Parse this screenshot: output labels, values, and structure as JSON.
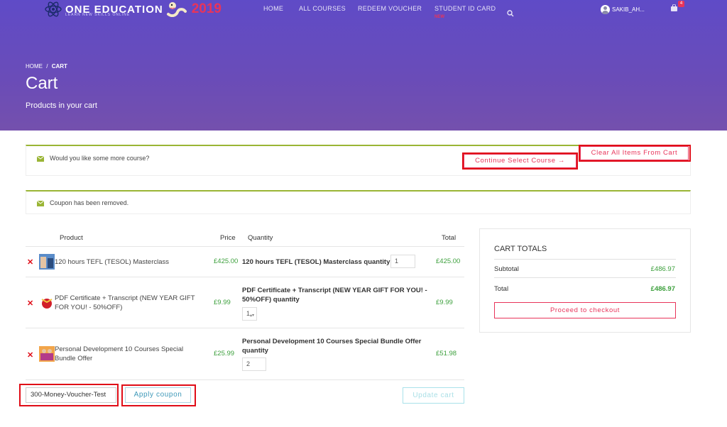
{
  "brand": {
    "name": "ONE EDUCATION",
    "tagline": "LEARN NEW SKILLS ONLINE",
    "year": "2019"
  },
  "nav": {
    "home": "HOME",
    "all_courses": "ALL COURSES",
    "redeem_voucher": "REDEEM VOUCHER",
    "student_id_card": "STUDENT ID CARD",
    "new_badge": "NEW"
  },
  "user": {
    "name": "SAKIB_AH..."
  },
  "cart": {
    "count": "4"
  },
  "breadcrumb": {
    "home": "HOME",
    "separator": "/",
    "current": "CART"
  },
  "page": {
    "title": "Cart",
    "subtitle": "Products in your cart"
  },
  "notices": {
    "more_course": "Would you like some more course?",
    "continue_label": "Continue Select Course →",
    "clear_label": "Clear All Items From Cart",
    "coupon_removed": "Coupon has been removed."
  },
  "table": {
    "headers": {
      "product": "Product",
      "price": "Price",
      "quantity": "Quantity",
      "total": "Total"
    },
    "rows": [
      {
        "name": "120 hours TEFL (TESOL) Masterclass",
        "name_line2": "",
        "price": "£425.00",
        "qty_label": "120 hours TEFL (TESOL) Masterclass quantity",
        "qty_label2": "",
        "qty": "1",
        "total": "£425.00"
      },
      {
        "name": "PDF Certificate + Transcript (NEW YEAR GIFT",
        "name_line2": "FOR YOU! - 50%OFF)",
        "price": "£9.99",
        "qty_label": "PDF Certificate + Transcript (NEW YEAR GIFT FOR YOU! -",
        "qty_label2": "50%OFF) quantity",
        "qty": "1",
        "total": "£9.99"
      },
      {
        "name": "Personal Development 10 Courses Special",
        "name_line2": "Bundle Offer",
        "price": "£25.99",
        "qty_label": "Personal Development 10 Courses Special Bundle Offer",
        "qty_label2": "quantity",
        "qty": "2",
        "total": "£51.98"
      }
    ]
  },
  "coupon": {
    "value": "300-Money-Voucher-Test",
    "apply_label": "Apply coupon",
    "update_label": "Update cart"
  },
  "totals": {
    "title": "CART TOTALS",
    "subtotal_label": "Subtotal",
    "subtotal": "£486.97",
    "total_label": "Total",
    "total": "£486.97",
    "checkout_label": "Proceed to checkout"
  },
  "colors": {
    "accent": "#e8345a",
    "price_green": "#3da03d",
    "notice_green": "#9ab535",
    "highlight_red": "#e00c17"
  }
}
